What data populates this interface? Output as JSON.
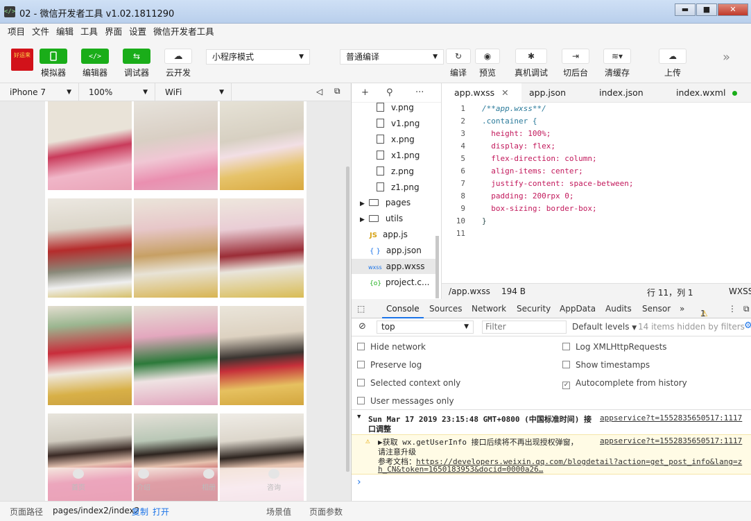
{
  "window": {
    "title": "02 - 微信开发者工具 v1.02.1811290",
    "app_icon": "</>",
    "controls": [
      "▬",
      "■",
      "✕"
    ]
  },
  "menu": [
    "项目",
    "文件",
    "编辑",
    "工具",
    "界面",
    "设置",
    "微信开发者工具"
  ],
  "toolbar": {
    "avatar_text": "好运来",
    "simulator": "模拟器",
    "editor": "编辑器",
    "debugger": "调试器",
    "cloud": "云开发",
    "mode": "小程序模式",
    "compile_mode": "普通编译",
    "compile": "编译",
    "preview": "预览",
    "remote_debug": "真机调试",
    "background": "切后台",
    "clear_cache": "清缓存",
    "upload": "上传",
    "more": "»"
  },
  "sim": {
    "device": "iPhone 7",
    "zoom": "100%",
    "network": "WiFi"
  },
  "tabbar": [
    "首页",
    "介绍",
    "相册",
    "咨询"
  ],
  "status": {
    "path_label": "页面路径",
    "path": "pages/index2/index2",
    "copy": "复制",
    "open": "打开",
    "scene": "场景值",
    "params": "页面参数"
  },
  "filetree": {
    "items": [
      "v.png",
      "v1.png",
      "x.png",
      "x1.png",
      "z.png",
      "z1.png",
      "pages",
      "utils",
      "app.js",
      "app.json",
      "app.wxss",
      "project.c..."
    ],
    "js_badge": "JS",
    "json_badge": "{ }",
    "wxss_badge": "wxss",
    "config_badge": "{o}"
  },
  "editor": {
    "tabs": [
      "app.wxss",
      "app.json",
      "index.json",
      "index.wxml"
    ],
    "close": "✕",
    "lines": [
      {
        "n": "1",
        "t": "/**app.wxss**/",
        "k": "cmt"
      },
      {
        "n": "2",
        "t": ".container {",
        "k": "sel2"
      },
      {
        "n": "3",
        "t": "  height: 100%;",
        "k": "prop"
      },
      {
        "n": "4",
        "t": "  display: flex;",
        "k": "prop"
      },
      {
        "n": "5",
        "t": "  flex-direction: column;",
        "k": "prop"
      },
      {
        "n": "6",
        "t": "  align-items: center;",
        "k": "prop"
      },
      {
        "n": "7",
        "t": "  justify-content: space-between;",
        "k": "prop"
      },
      {
        "n": "8",
        "t": "  padding: 200rpx 0;",
        "k": "prop"
      },
      {
        "n": "9",
        "t": "  box-sizing: border-box;",
        "k": "prop"
      },
      {
        "n": "10",
        "t": "}",
        "k": "val"
      },
      {
        "n": "11",
        "t": "",
        "k": "val"
      }
    ],
    "status_file": "/app.wxss",
    "status_size": "194 B",
    "status_pos": "行 11，列 1",
    "status_lang": "WXSS"
  },
  "devtools": {
    "tabs": [
      "Console",
      "Sources",
      "Network",
      "Security",
      "AppData",
      "Audits",
      "Sensor"
    ],
    "more": "»",
    "warn_count": "1",
    "context": "top",
    "filter_placeholder": "Filter",
    "levels": "Default levels",
    "hidden": "14 items hidden by filters",
    "options_left": [
      "Hide network",
      "Preserve log",
      "Selected context only",
      "User messages only"
    ],
    "options_right": [
      "Log XMLHttpRequests",
      "Show timestamps",
      "Autocomplete from history"
    ],
    "log1_a": "Sun Mar 17 2019 23:15:48 GMT+0800 (中国标准时间) 接",
    "log1_b": "口调整",
    "log1_src": "appservice?t=1552835650517:1117",
    "warn_a": "▶获取  wx.getUserInfo 接口后续将不再出现授权弹窗，",
    "warn_b": "请注意升级",
    "warn_c": "参考文档：",
    "warn_link_a": "https://developers.weixin.qq.com/blogdetail?action=get_post_info&lang=z",
    "warn_link_b": "h_CN&token=1650183953&docid=0000a26…",
    "warn_src": "appservice?t=1552835650517:1117",
    "prompt": "›"
  },
  "colors": {
    "accent": "#1aad19",
    "warn_bg": "#fffbe5",
    "link": "#1a73e8"
  }
}
